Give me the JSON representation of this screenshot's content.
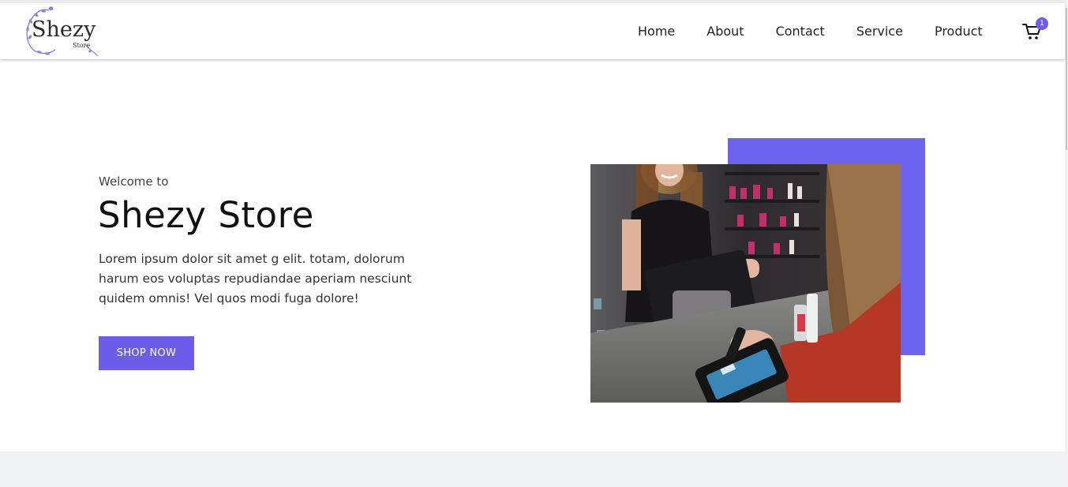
{
  "brand": {
    "logo_text": "Shezy",
    "logo_subtext": "Store",
    "accent_color": "#6c5ce7"
  },
  "nav": {
    "items": [
      {
        "label": "Home"
      },
      {
        "label": "About"
      },
      {
        "label": "Contact"
      },
      {
        "label": "Service"
      },
      {
        "label": "Product"
      }
    ],
    "cart": {
      "icon": "cart-icon",
      "count": "1"
    }
  },
  "hero": {
    "eyebrow": "Welcome to",
    "title": "Shezy Store",
    "description": "Lorem ipsum dolor sit amet g elit. totam, dolorum harum eos voluptas repudiandae aperiam nesciunt quidem omnis! Vel quos modi fuga dolore!",
    "cta_label": "SHOP NOW",
    "image_subject": "shop-checkout-photo"
  }
}
